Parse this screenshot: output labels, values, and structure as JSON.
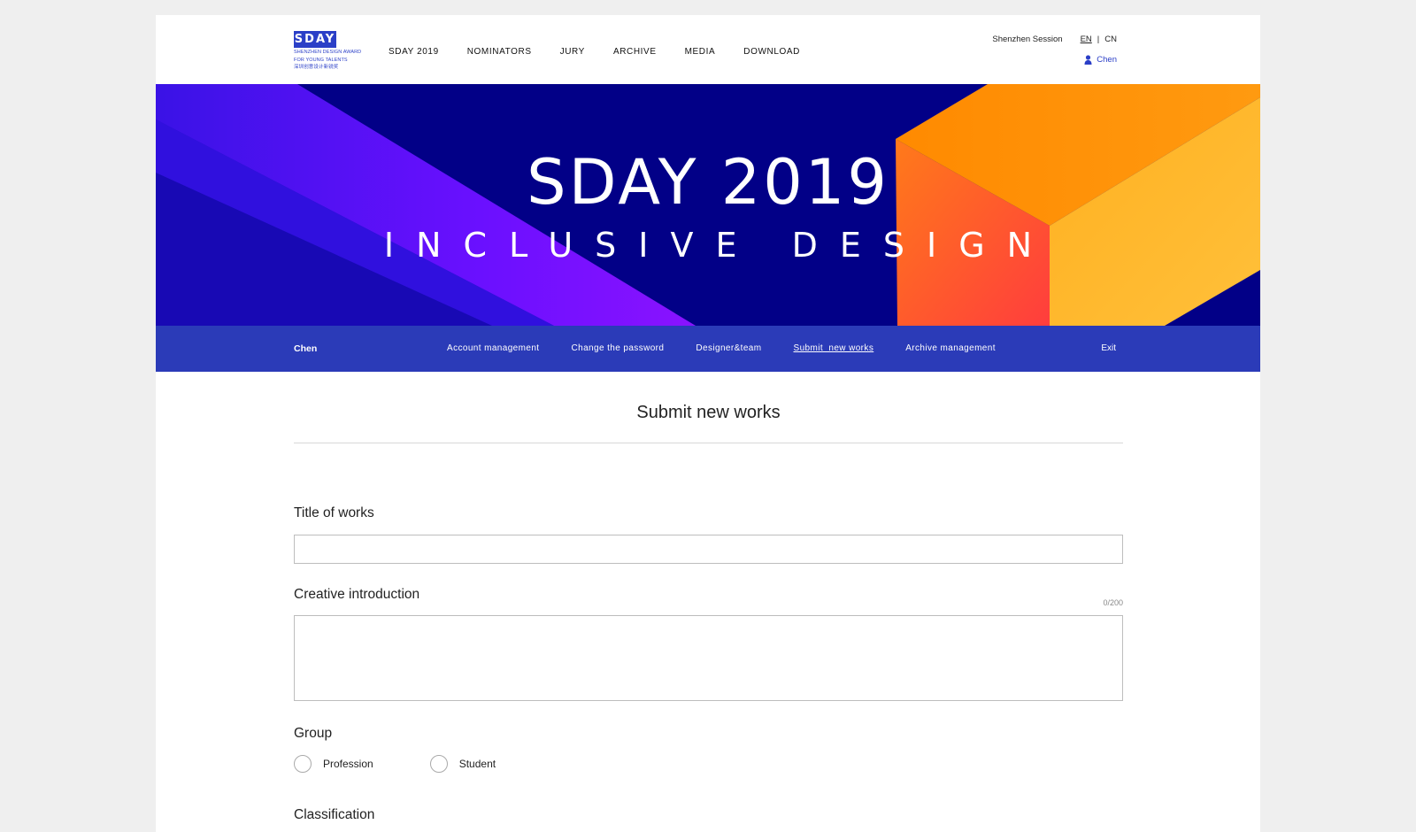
{
  "header": {
    "logo": {
      "mark": "SDAY",
      "line1": "SHENZHEN DESIGN AWARD",
      "line2": "FOR YOUNG TALENTS",
      "line3": "深圳创意设计新锐奖"
    },
    "nav": [
      "SDAY 2019",
      "NOMINATORS",
      "JURY",
      "ARCHIVE",
      "MEDIA",
      "DOWNLOAD"
    ],
    "session": "Shenzhen Session",
    "lang_en": "EN",
    "lang_sep": "|",
    "lang_cn": "CN",
    "user": "Chen"
  },
  "banner": {
    "title": "SDAY 2019",
    "subtitle": "INCLUSIVE DESIGN"
  },
  "subnav": {
    "user": "Chen",
    "links": [
      "Account management",
      "Change the password",
      "Designer&team",
      "Submit  new works",
      "Archive management"
    ],
    "active_index": 3,
    "exit": "Exit"
  },
  "form": {
    "page_title": "Submit new works",
    "title_label": "Title of works",
    "title_value": "",
    "intro_label": "Creative introduction",
    "intro_counter": "0/200",
    "intro_value": "",
    "group_label": "Group",
    "group_options": [
      "Profession",
      "Student"
    ],
    "classification_label": "Classification"
  },
  "colors": {
    "brand_blue": "#2b3fc7",
    "subnav_blue": "#2b3bb8",
    "banner_navy": "#020087",
    "banner_purple": "#7a12ff",
    "banner_orange": "#ff8a00"
  }
}
